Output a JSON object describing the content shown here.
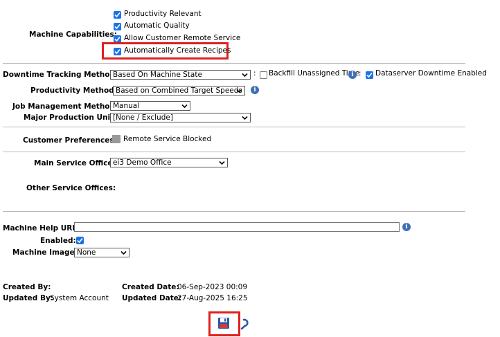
{
  "capabilities": {
    "label": "Machine Capabilities:",
    "items": [
      {
        "label": "Productivity Relevant",
        "checked": true
      },
      {
        "label": "Automatic Quality",
        "checked": true
      },
      {
        "label": "Allow Customer Remote Service",
        "checked": true
      },
      {
        "label": "Automatically Create Recipes",
        "checked": true
      }
    ]
  },
  "downtime": {
    "label": "Downtime Tracking Method:",
    "value": "Based On Machine State",
    "colon": ":",
    "backfill_label": "Backfill Unassigned Time",
    "backfill_checked": false,
    "dataserver_label": "Dataserver Downtime Enabled",
    "dataserver_checked": true
  },
  "productivity": {
    "label": "Productivity Method:",
    "value": "Based on Combined Target Speeds"
  },
  "job": {
    "label": "Job Management Method:",
    "value": "Manual"
  },
  "unit": {
    "label": "Major Production Unit:",
    "value": "[None / Exclude]"
  },
  "preferences": {
    "label": "Customer Preferences:",
    "value": "Remote Service Blocked"
  },
  "office": {
    "label": "Main Service Office:",
    "value": "ei3 Demo Office"
  },
  "other_offices": {
    "label": "Other Service Offices:"
  },
  "help_url": {
    "label": "Machine Help URL:",
    "value": ""
  },
  "enabled": {
    "label": "Enabled:",
    "checked": true
  },
  "image": {
    "label": "Machine Image:",
    "value": "None"
  },
  "audit": {
    "created_by_label": "Created By:",
    "created_by": "",
    "updated_by_label": "Updated By:",
    "updated_by": "System Account",
    "created_date_label": "Created Date:",
    "created_date": "06-Sep-2023 00:09",
    "updated_date_label": "Updated Date:",
    "updated_date": "27-Aug-2025 16:25"
  },
  "icons": {
    "save": "floppy-disk-icon",
    "undo": "undo-icon",
    "info": "info-icon"
  },
  "colors": {
    "checkbox": "#1a73e8",
    "highlight": "#e01f1f",
    "info": "#3f6fb6"
  }
}
